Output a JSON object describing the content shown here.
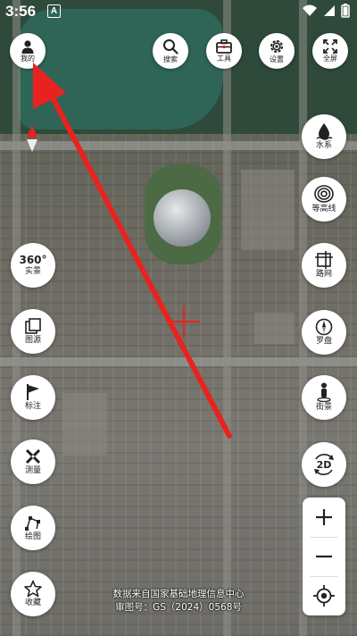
{
  "status_bar": {
    "time": "3:56",
    "app_badge": "A",
    "icons": [
      "wifi-icon",
      "signal-icon",
      "battery-icon"
    ]
  },
  "top_bar": {
    "profile_label": "我的",
    "search_label": "搜索",
    "tools_label": "工具",
    "settings_label": "设置",
    "fullscreen_label": "全屏"
  },
  "right_panel": {
    "water_label": "水系",
    "contour_label": "等高线",
    "road_label": "路网",
    "compass_label": "罗盘",
    "street_label": "街景",
    "mode_2d_label": "2D"
  },
  "left_panel": {
    "panorama_badge": "360°",
    "panorama_label": "实景",
    "source_label": "图源",
    "mark_label": "标注",
    "measure_label": "测量",
    "draw_label": "绘图",
    "favorite_label": "收藏"
  },
  "zoom": {
    "plus": "+",
    "minus": "−"
  },
  "attribution": {
    "line1": "数据来自国家基础地理信息中心",
    "line2": "审图号：GS（2024）0568号"
  },
  "colors": {
    "annotation_arrow": "#e8231f",
    "button_bg": "#ffffff",
    "icon_dark": "#222222"
  }
}
